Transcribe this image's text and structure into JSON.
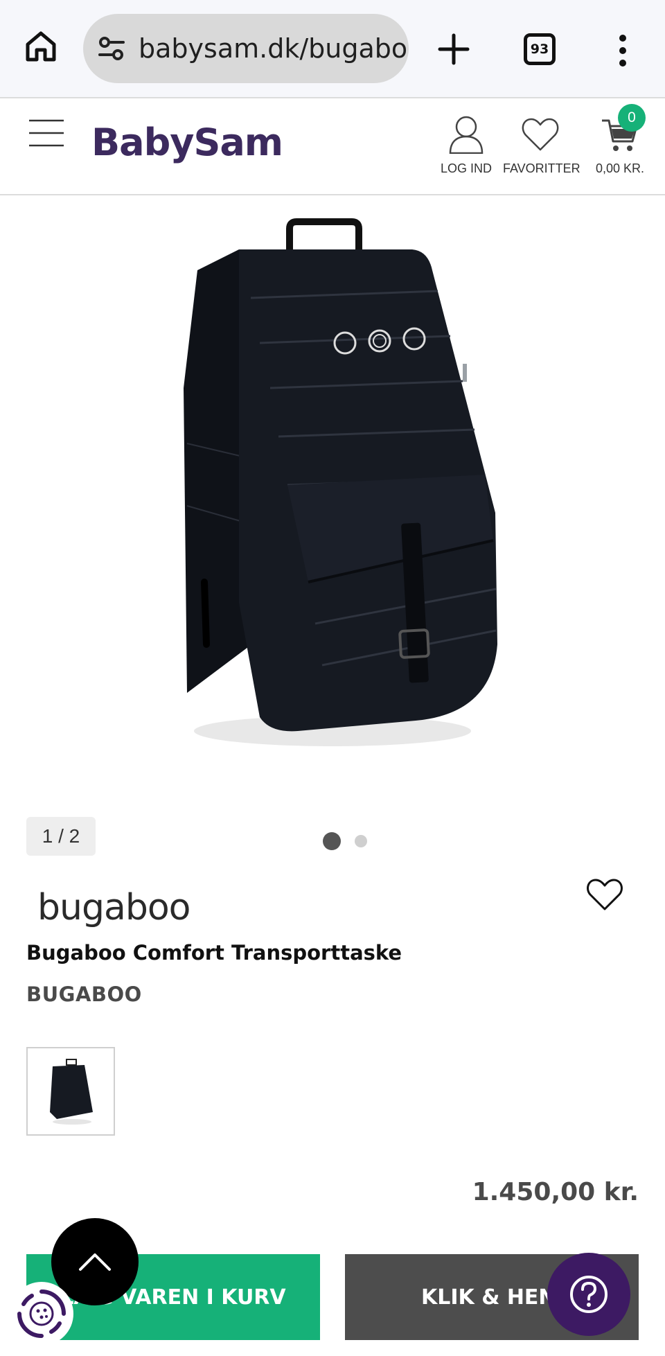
{
  "browser": {
    "url": "babysam.dk/bugaboo",
    "tab_count": "93"
  },
  "header": {
    "menu_label": "MENU",
    "logo_text": "BabySam",
    "login_label": "LOG IND",
    "favorites_label": "FAVORITTER",
    "cart_total": "0,00 KR.",
    "cart_count": "0"
  },
  "gallery": {
    "counter": "1 / 2"
  },
  "product": {
    "brand_logo_text": "bugaboo",
    "title": "Bugaboo Comfort Transporttaske",
    "brand": "BUGABOO",
    "price": "1.450,00 kr."
  },
  "actions": {
    "add_to_cart_label": "LÆG VAREN I KURV",
    "click_collect_label": "KLIK & HENT"
  },
  "colors": {
    "brand_purple": "#3c2a5e",
    "accent_green": "#16b178",
    "button_gray": "#4d4d4d",
    "help_purple": "#3d1a63"
  }
}
